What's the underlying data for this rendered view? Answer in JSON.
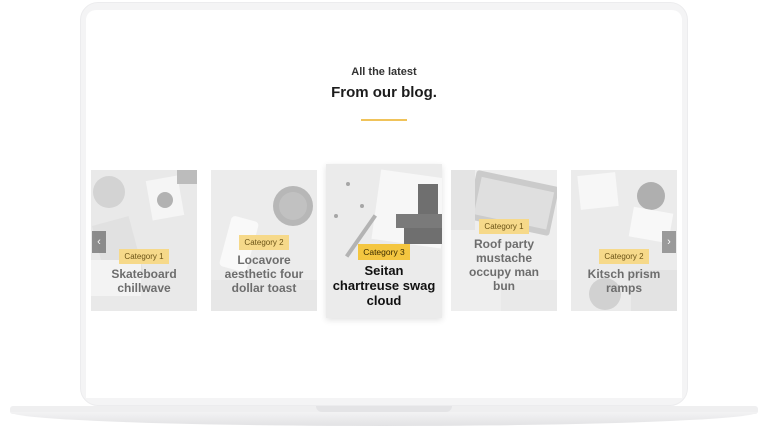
{
  "section": {
    "eyebrow": "All the latest",
    "heading": "From our blog."
  },
  "posts": [
    {
      "category": "Category 1",
      "title": "Skateboard chillwave"
    },
    {
      "category": "Category 2",
      "title": "Locavore aesthetic four dollar toast"
    },
    {
      "category": "Category 3",
      "title": "Seitan chartreuse swag cloud"
    },
    {
      "category": "Category 1",
      "title": "Roof party mustache occupy man bun"
    },
    {
      "category": "Category 2",
      "title": "Kitsch prism ramps"
    }
  ],
  "carousel": {
    "prev_icon": "chevron-left-icon",
    "next_icon": "chevron-right-icon",
    "prev_glyph": "‹",
    "next_glyph": "›"
  },
  "colors": {
    "accent": "#f0c35a",
    "badge": "#f6d98a",
    "badge_active": "#f4c640"
  }
}
